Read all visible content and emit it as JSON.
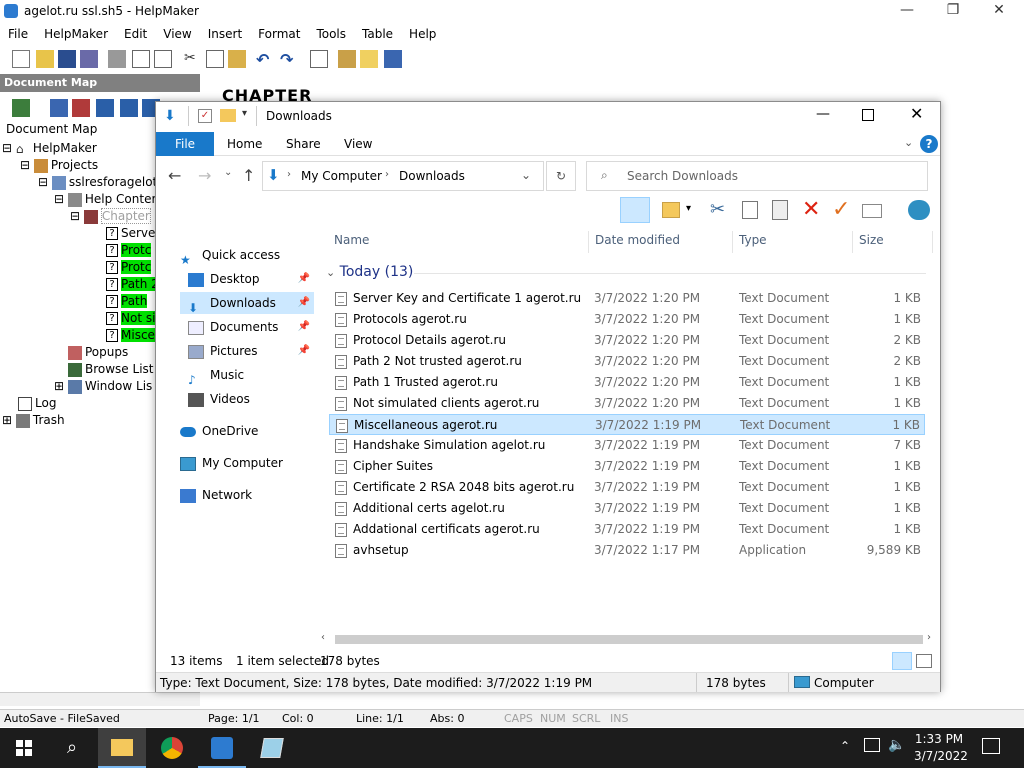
{
  "helpmaker": {
    "title": "agelot.ru ssl.sh5 - HelpMaker",
    "window_controls": {
      "minimize": "—",
      "maximize": "❐",
      "close": "✕"
    },
    "menu": [
      "File",
      "HelpMaker",
      "Edit",
      "View",
      "Insert",
      "Format",
      "Tools",
      "Table",
      "Help"
    ],
    "docmap_header": "Document Map",
    "docmap_label": "Document Map",
    "chapter_heading": "CHAPTER",
    "tree": {
      "root": "HelpMaker",
      "projects": "Projects",
      "project": "sslresforagelot",
      "help_contents": "Help Conter",
      "chapter": "Chapter",
      "topics": [
        "Serve",
        "Protc",
        "Protc",
        "Path 2",
        "Path",
        "Not si",
        "Misce"
      ],
      "popups": "Popups",
      "browse_list": "Browse List",
      "window_list": "Window Lis",
      "log": "Log",
      "trash": "Trash"
    },
    "status": {
      "autosave": "AutoSave - FileSaved",
      "page": "Page: 1/1",
      "col": "Col: 0",
      "line": "Line: 1/1",
      "abs": "Abs: 0",
      "caps": "CAPS",
      "num": "NUM",
      "scrl": "SCRL",
      "ins": "INS"
    }
  },
  "explorer": {
    "title": "Downloads",
    "ribbon_tabs": [
      "File",
      "Home",
      "Share",
      "View"
    ],
    "address": {
      "segments": [
        "My Computer",
        "Downloads"
      ]
    },
    "search_placeholder": "Search Downloads",
    "nav": [
      {
        "label": "Quick access",
        "icon": "star-icon"
      },
      {
        "label": "Desktop",
        "icon": "desktop-icon",
        "pinned": true
      },
      {
        "label": "Downloads",
        "icon": "download-icon",
        "pinned": true,
        "selected": true
      },
      {
        "label": "Documents",
        "icon": "documents-icon",
        "pinned": true
      },
      {
        "label": "Pictures",
        "icon": "pictures-icon",
        "pinned": true
      },
      {
        "label": "Music",
        "icon": "music-icon"
      },
      {
        "label": "Videos",
        "icon": "videos-icon"
      },
      {
        "label": "OneDrive",
        "icon": "cloud-icon"
      },
      {
        "label": "My Computer",
        "icon": "computer-icon"
      },
      {
        "label": "Network",
        "icon": "network-icon"
      }
    ],
    "columns": [
      "Name",
      "Date modified",
      "Type",
      "Size"
    ],
    "group": "Today (13)",
    "files": [
      [
        "Server Key and Certificate 1 agerot.ru",
        "3/7/2022 1:20 PM",
        "Text Document",
        "1 KB"
      ],
      [
        "Protocols agerot.ru",
        "3/7/2022 1:20 PM",
        "Text Document",
        "1 KB"
      ],
      [
        "Protocol Details agerot.ru",
        "3/7/2022 1:20 PM",
        "Text Document",
        "2 KB"
      ],
      [
        "Path 2 Not trusted agerot.ru",
        "3/7/2022 1:20 PM",
        "Text Document",
        "2 KB"
      ],
      [
        "Path 1 Trusted agerot.ru",
        "3/7/2022 1:20 PM",
        "Text Document",
        "1 KB"
      ],
      [
        "Not simulated clients agerot.ru",
        "3/7/2022 1:20 PM",
        "Text Document",
        "1 KB"
      ],
      [
        "Miscellaneous agerot.ru",
        "3/7/2022 1:19 PM",
        "Text Document",
        "1 KB"
      ],
      [
        "Handshake Simulation agelot.ru",
        "3/7/2022 1:19 PM",
        "Text Document",
        "7 KB"
      ],
      [
        "Cipher Suites",
        "3/7/2022 1:19 PM",
        "Text Document",
        "1 KB"
      ],
      [
        "Certificate 2 RSA 2048 bits agerot.ru",
        "3/7/2022 1:19 PM",
        "Text Document",
        "1 KB"
      ],
      [
        "Additional certs agelot.ru",
        "3/7/2022 1:19 PM",
        "Text Document",
        "1 KB"
      ],
      [
        "Addational certificats  agerot.ru",
        "3/7/2022 1:19 PM",
        "Text Document",
        "1 KB"
      ],
      [
        "avhsetup",
        "3/7/2022 1:17 PM",
        "Application",
        "9,589 KB"
      ]
    ],
    "selected_index": 6,
    "status": {
      "count": "13 items",
      "selected": "1 item selected",
      "size": "178 bytes"
    },
    "details_bar": {
      "info": "Type: Text Document, Size: 178 bytes, Date modified: 3/7/2022 1:19 PM",
      "size": "178 bytes",
      "location": "Computer"
    }
  },
  "taskbar": {
    "time": "1:33 PM",
    "date": "3/7/2022"
  }
}
